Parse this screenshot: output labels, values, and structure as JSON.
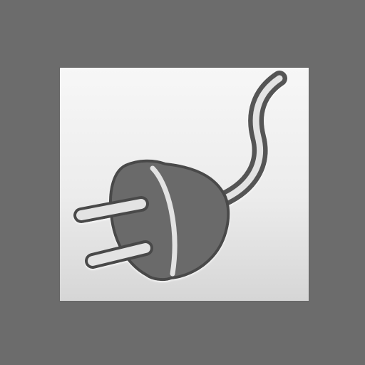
{
  "icon": {
    "name": "power-plug-icon",
    "colors": {
      "background": "#6c6c6c",
      "tile_light": "#f7f7f7",
      "tile_dark": "#d6d6d6",
      "plug": "#6b6b6b",
      "outline": "#4a4a4a",
      "highlight": "#e3e3e3"
    }
  }
}
